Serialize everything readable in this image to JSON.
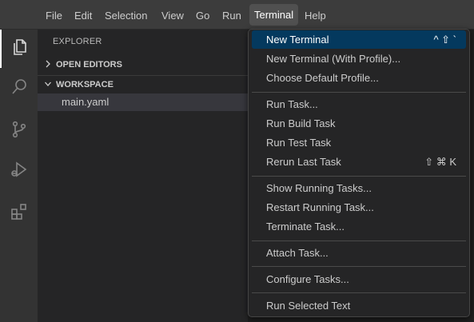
{
  "menubar": {
    "items": [
      "File",
      "Edit",
      "Selection",
      "View",
      "Go",
      "Run",
      "Terminal",
      "Help"
    ],
    "active": "Terminal"
  },
  "activity_bar": {
    "icons": [
      "files-icon",
      "search-icon",
      "source-control-icon",
      "run-debug-icon",
      "extensions-icon"
    ]
  },
  "sidebar": {
    "title": "EXPLORER",
    "sections": [
      {
        "label": "OPEN EDITORS",
        "expanded": false
      },
      {
        "label": "WORKSPACE",
        "expanded": true
      }
    ],
    "files": [
      "main.yaml"
    ]
  },
  "terminal_menu": {
    "groups": [
      [
        {
          "label": "New Terminal",
          "shortcut": "^ ⇧ `",
          "highlighted": true
        },
        {
          "label": "New Terminal (With Profile)...",
          "shortcut": ""
        },
        {
          "label": "Choose Default Profile...",
          "shortcut": ""
        }
      ],
      [
        {
          "label": "Run Task...",
          "shortcut": ""
        },
        {
          "label": "Run Build Task",
          "shortcut": ""
        },
        {
          "label": "Run Test Task",
          "shortcut": ""
        },
        {
          "label": "Rerun Last Task",
          "shortcut": "⇧ ⌘ K"
        }
      ],
      [
        {
          "label": "Show Running Tasks...",
          "shortcut": ""
        },
        {
          "label": "Restart Running Task...",
          "shortcut": ""
        },
        {
          "label": "Terminate Task...",
          "shortcut": ""
        }
      ],
      [
        {
          "label": "Attach Task...",
          "shortcut": ""
        }
      ],
      [
        {
          "label": "Configure Tasks...",
          "shortcut": ""
        }
      ],
      [
        {
          "label": "Run Selected Text",
          "shortcut": ""
        }
      ]
    ]
  },
  "colors": {
    "highlight": "#04395e",
    "menubar_bg": "#3c3c3c",
    "sidebar_bg": "#252526",
    "activity_bg": "#333333"
  }
}
